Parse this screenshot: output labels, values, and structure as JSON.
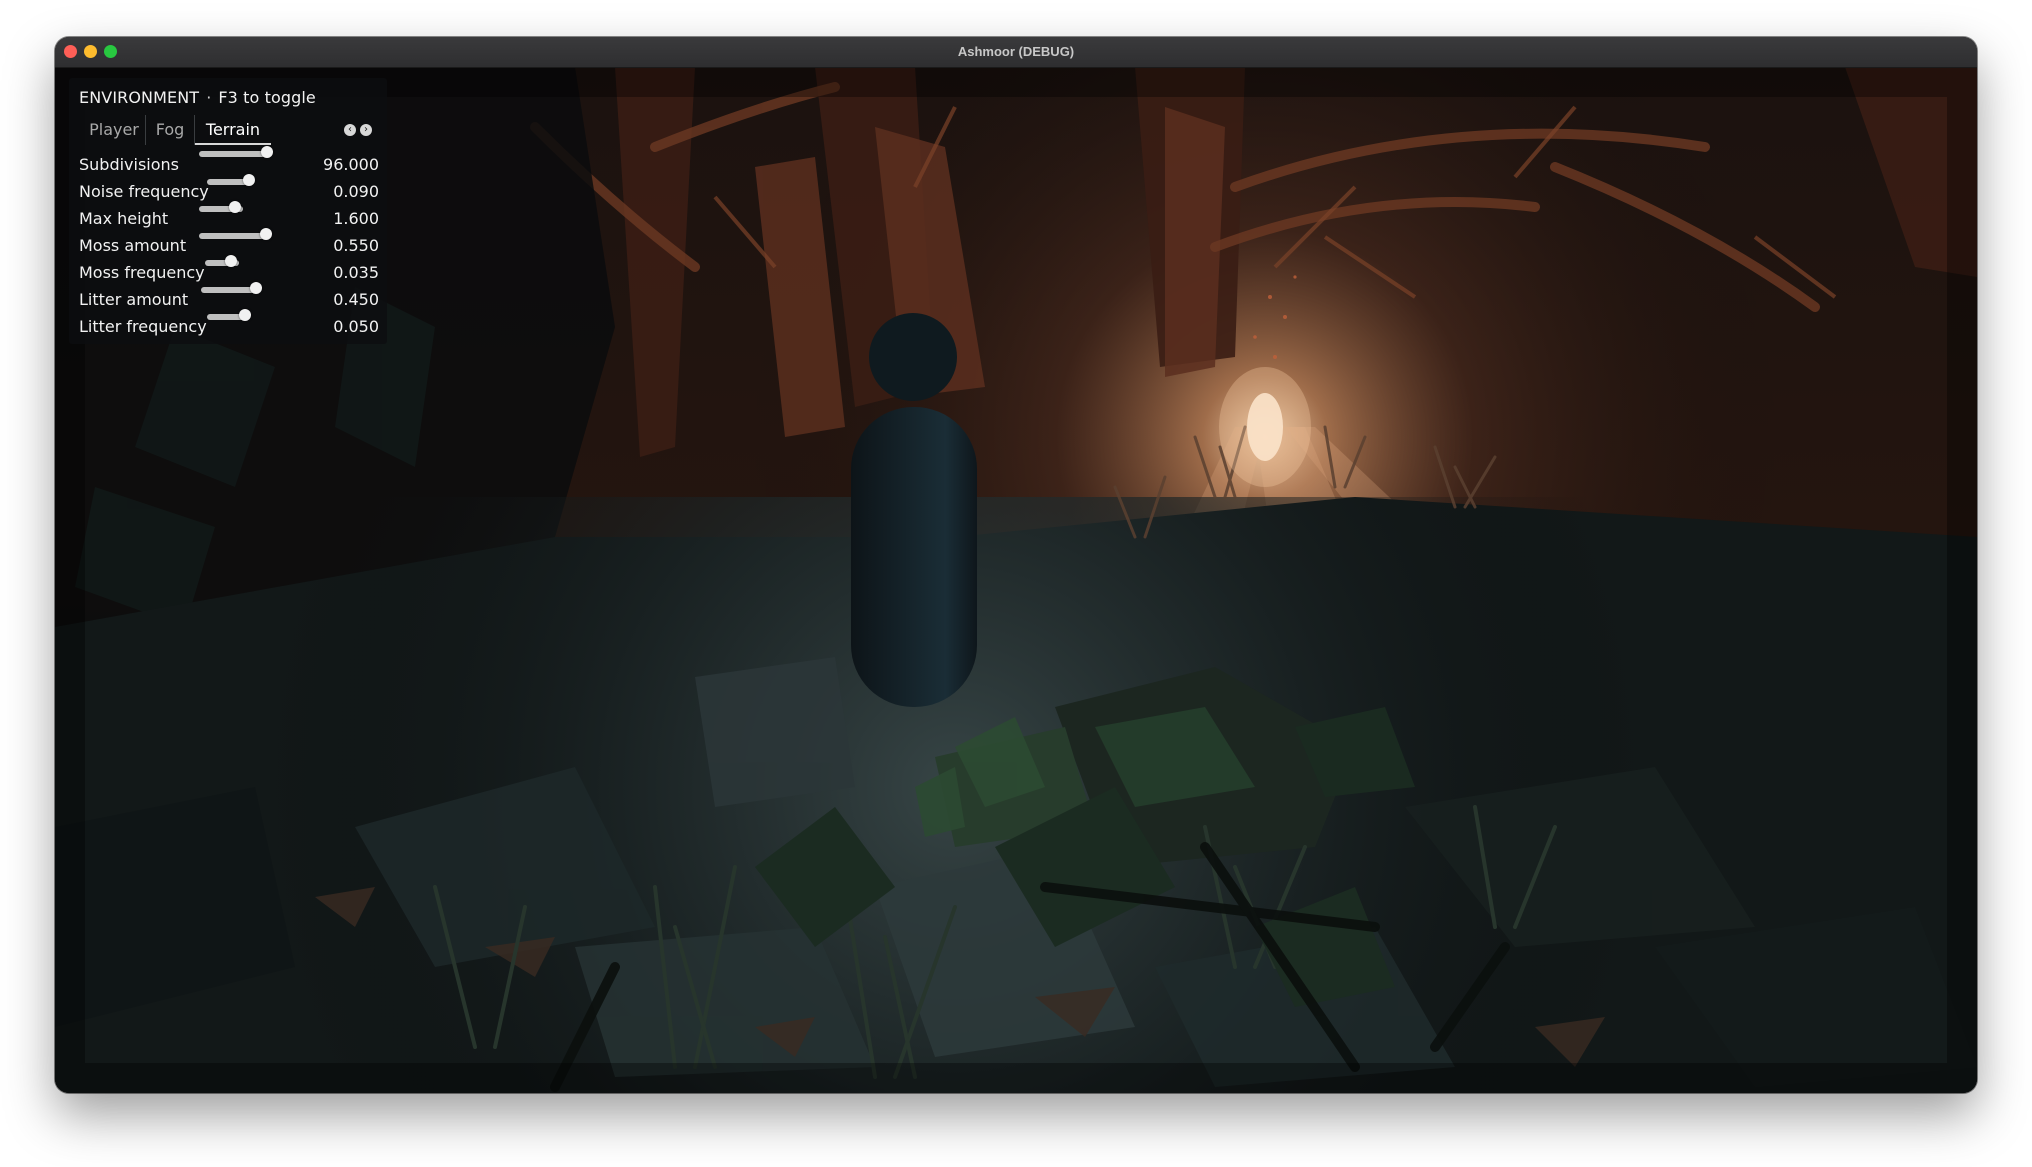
{
  "window": {
    "title": "Ashmoor (DEBUG)"
  },
  "panel": {
    "header_title": "ENVIRONMENT",
    "header_separator": "·",
    "header_hint": "F3 to toggle",
    "tabs": [
      {
        "label": "Player",
        "active": false
      },
      {
        "label": "Fog",
        "active": false
      },
      {
        "label": "Terrain",
        "active": true
      }
    ],
    "tab_prev_icon": "chevron-left-icon",
    "tab_next_icon": "chevron-right-icon",
    "sliders": [
      {
        "label": "Subdivisions",
        "value": "96.000",
        "fill": 0.9
      },
      {
        "label": "Noise frequency",
        "value": "0.090",
        "fill": 0.75
      },
      {
        "label": "Max height",
        "value": "1.600",
        "fill": 0.5
      },
      {
        "label": "Moss amount",
        "value": "0.550",
        "fill": 0.88
      },
      {
        "label": "Moss frequency",
        "value": "0.035",
        "fill": 0.6
      },
      {
        "label": "Litter amount",
        "value": "0.450",
        "fill": 0.75
      },
      {
        "label": "Litter frequency",
        "value": "0.050",
        "fill": 0.8
      }
    ]
  },
  "scene": {
    "description_icon": "game-viewport",
    "colors": {
      "glow": "#f3c9a0",
      "shadow": "#0b0c0e",
      "wood": "#5a2e1e",
      "foliage": "#233b2a"
    }
  }
}
